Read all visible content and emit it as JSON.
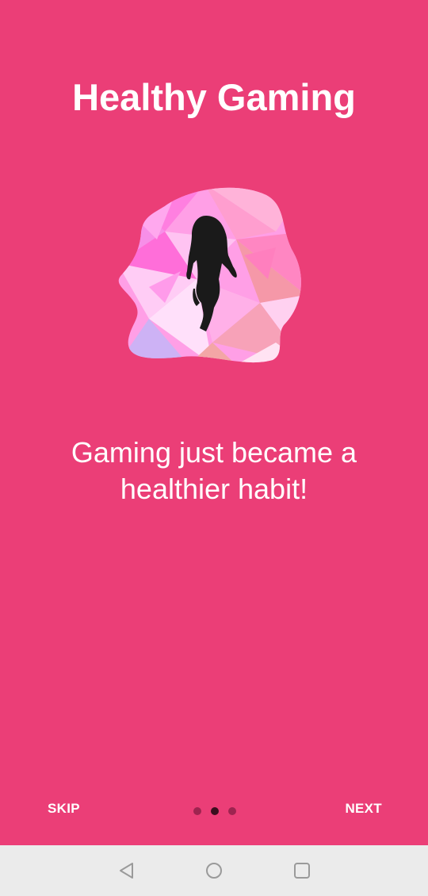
{
  "onboarding": {
    "title": "Healthy Gaming",
    "subtitle_line1": "Gaming just became a",
    "subtitle_line2": "healthier habit!",
    "illustration_icon": "girl-running-silhouette-on-polygon-blob",
    "skip_label": "SKIP",
    "next_label": "NEXT",
    "page_indicator": {
      "total": 3,
      "current": 2
    }
  },
  "system_nav": {
    "back_icon": "triangle-back-icon",
    "home_icon": "circle-home-icon",
    "recents_icon": "square-recents-icon"
  },
  "colors": {
    "background": "#EB3E77",
    "text": "#FFFFFF",
    "dot_inactive": "#9E2450",
    "dot_active": "#3A0E1E",
    "navbar": "#EBEBEB"
  }
}
